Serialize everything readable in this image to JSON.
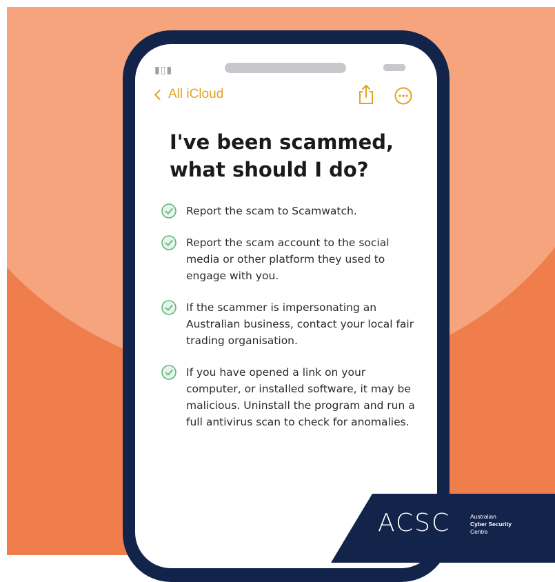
{
  "notes_header": {
    "back_label": "All iCloud"
  },
  "note": {
    "title_line1": "I've been scammed,",
    "title_line2": "what should I do?",
    "items": [
      {
        "text": "Report the scam to Scamwatch."
      },
      {
        "text": "Report the scam account to the social media or other platform they used to engage with you."
      },
      {
        "text": "If the scammer is impersonating an Australian business, contact your local fair trading organisation."
      },
      {
        "text": "If you have opened a link on your computer, or installed software, it may be malicious. Uninstall the program and run a full antivirus scan to check for anomalies."
      }
    ]
  },
  "branding": {
    "logo": "ACSC",
    "line1": "Australian",
    "line2": "Cyber Security",
    "line3": "Centre"
  },
  "colors": {
    "background_orange": "#ef7e4c",
    "background_light": "#f6a47d",
    "phone_frame": "#12244a",
    "accent_yellow": "#e2a31f",
    "check_green": "#5cb87a"
  },
  "icons": {
    "back": "chevron-left-icon",
    "share": "share-icon",
    "more": "more-icon",
    "check": "check-circle-icon"
  }
}
